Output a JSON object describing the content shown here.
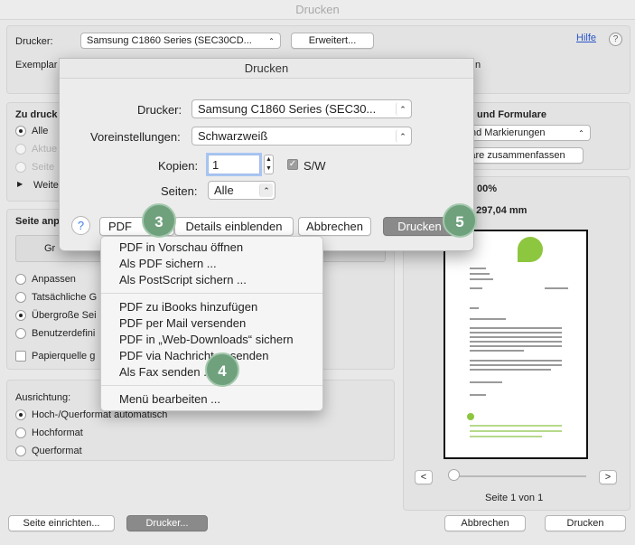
{
  "window": {
    "title": "Drucken"
  },
  "main": {
    "printer_label": "Drucker:",
    "printer_value": "Samsung C1860 Series (SEC30CD...",
    "advanced_button": "Erweitert...",
    "help_link": "Hilfe",
    "copies_label": "Exemplar",
    "copies_suffix": "n",
    "print_range": {
      "title": "Zu druck",
      "options": [
        "Alle",
        "Aktue",
        "Seite"
      ],
      "more": "Weite"
    },
    "forms": {
      "title": "und Formulare",
      "select_value": "nd Markierungen",
      "summarize_button": "are zusammenfassen"
    },
    "page_adjust": {
      "title": "Seite anp",
      "size_button": "Gr",
      "options": [
        "Anpassen",
        "Tatsächliche G",
        "Übergroße Sei",
        "Benutzerdefini"
      ],
      "paper_source": "Papierquelle g"
    },
    "scale": {
      "percent": "00%",
      "size": "x 297,04 mm"
    },
    "orientation": {
      "label": "Ausrichtung:",
      "options": [
        "Hoch-/Querformat automatisch",
        "Hochformat",
        "Querformat"
      ]
    },
    "preview": {
      "prev": "<",
      "next": ">",
      "page_label": "Seite 1 von 1"
    },
    "footer": {
      "page_setup": "Seite einrichten...",
      "printer_button": "Drucker...",
      "cancel": "Abbrechen",
      "print": "Drucken"
    }
  },
  "sheet": {
    "title": "Drucken",
    "printer_label": "Drucker:",
    "printer_value": "Samsung C1860 Series (SEC30...",
    "presets_label": "Voreinstellungen:",
    "presets_value": "Schwarzweiß",
    "copies_label": "Kopien:",
    "copies_value": "1",
    "bw_label": "S/W",
    "pages_label": "Seiten:",
    "pages_value": "Alle",
    "help": "?",
    "pdf_button": "PDF",
    "details_button": "Details einblenden",
    "cancel": "Abbrechen",
    "print": "Drucken"
  },
  "pdf_menu": {
    "items": [
      "PDF in Vorschau öffnen",
      "Als PDF sichern ...",
      "Als PostScript sichern ...",
      "PDF zu iBooks hinzufügen",
      "PDF per Mail versenden",
      "PDF in „Web-Downloads“ sichern",
      "PDF via Nachrichten senden",
      "Als Fax senden ...",
      "Menü bearbeiten ..."
    ]
  },
  "badges": [
    "3",
    "4",
    "5"
  ],
  "colors": {
    "badge": "#6fa17d",
    "accent": "#3f7fe6",
    "logo_green": "#8dc63f"
  }
}
